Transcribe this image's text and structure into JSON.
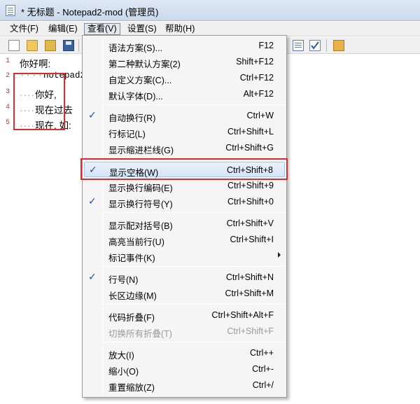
{
  "window": {
    "title": "* 无标题 - Notepad2-mod (管理员)"
  },
  "menubar": [
    {
      "label": "文件(F)"
    },
    {
      "label": "编辑(E)"
    },
    {
      "label": "查看(V)"
    },
    {
      "label": "设置(S)"
    },
    {
      "label": "帮助(H)"
    }
  ],
  "toolbar": {
    "icons": [
      "new-file-icon",
      "open-file-icon",
      "browse-icon",
      "save-icon",
      "list-icon",
      "check-icon",
      "exit-icon"
    ]
  },
  "editor": {
    "lines": [
      {
        "num": "1",
        "text": "你好啊:"
      },
      {
        "num": "2",
        "ws": "····",
        "text": "notepad2:"
      },
      {
        "num": "3",
        "ws": "····",
        "text": "你好,"
      },
      {
        "num": "4",
        "ws": "····",
        "text": "现在过去"
      },
      {
        "num": "5",
        "ws": "····",
        "text": "现在, 如:"
      }
    ]
  },
  "view_menu": {
    "items": [
      {
        "label": "语法方案(S)...",
        "shortcut": "F12",
        "checked": false
      },
      {
        "label": "第二种默认方案(2)",
        "shortcut": "Shift+F12",
        "checked": false
      },
      {
        "label": "自定义方案(C)...",
        "shortcut": "Ctrl+F12",
        "checked": false
      },
      {
        "label": "默认字体(D)...",
        "shortcut": "Alt+F12",
        "checked": false
      },
      {
        "label": "自动换行(R)",
        "shortcut": "Ctrl+W",
        "checked": true
      },
      {
        "label": "行标记(L)",
        "shortcut": "Ctrl+Shift+L",
        "checked": false
      },
      {
        "label": "显示缩进栏线(G)",
        "shortcut": "Ctrl+Shift+G",
        "checked": false
      },
      {
        "label": "显示空格(W)",
        "shortcut": "Ctrl+Shift+8",
        "checked": true
      },
      {
        "label": "显示换行编码(E)",
        "shortcut": "Ctrl+Shift+9",
        "checked": false
      },
      {
        "label": "显示换行符号(Y)",
        "shortcut": "Ctrl+Shift+0",
        "checked": true
      },
      {
        "label": "显示配对括号(B)",
        "shortcut": "Ctrl+Shift+V",
        "checked": false
      },
      {
        "label": "高亮当前行(U)",
        "shortcut": "Ctrl+Shift+I",
        "checked": false
      },
      {
        "label": "标记事件(K)",
        "shortcut": "",
        "checked": false
      },
      {
        "label": "行号(N)",
        "shortcut": "Ctrl+Shift+N",
        "checked": true
      },
      {
        "label": "长区边缘(M)",
        "shortcut": "Ctrl+Shift+M",
        "checked": false
      },
      {
        "label": "代码折叠(F)",
        "shortcut": "Ctrl+Shift+Alt+F",
        "checked": false
      },
      {
        "label": "切换所有折叠(T)",
        "shortcut": "Ctrl+Shift+F",
        "checked": false,
        "disabled": true
      },
      {
        "label": "放大(I)",
        "shortcut": "Ctrl++",
        "checked": false
      },
      {
        "label": "缩小(O)",
        "shortcut": "Ctrl+-",
        "checked": false
      },
      {
        "label": "重置缩放(Z)",
        "shortcut": "Ctrl+/",
        "checked": false
      }
    ],
    "check_glyph": "✓"
  }
}
